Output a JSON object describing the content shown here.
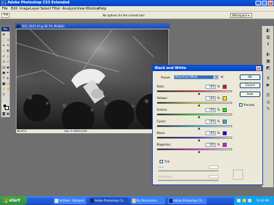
{
  "window": {
    "app_title": "Adobe Photoshop CS3 Extended",
    "minimize": "_",
    "maximize": "□",
    "close": "×"
  },
  "menubar": {
    "items": [
      "File",
      "Edit",
      "Image",
      "Layer",
      "Select",
      "Filter",
      "Analysis",
      "View",
      "Window",
      "Help"
    ]
  },
  "options_bar": {
    "tool_preset_icon": "eyedropper-icon",
    "message": "No options for the current tool.",
    "workspace_label": "Workspace ▾"
  },
  "toolbox": {
    "badge": "Ps"
  },
  "document": {
    "title": "DSC_0012.tif @ 66.7% (RGB/8)",
    "zoom_status": "66.67%",
    "doc_size": "Doc: 5.25M/5.25M"
  },
  "bw_dialog": {
    "title": "Black and White",
    "preset_label": "Preset:",
    "preset_value": "Maximum White",
    "ok_label": "OK",
    "cancel_label": "Cancel",
    "auto_label": "Auto",
    "preview_label": "Preview",
    "preview_checked": true,
    "sliders": [
      {
        "label": "Reds:",
        "value": "100",
        "unit": "%",
        "color": "#ff0000",
        "fraction": 0.56
      },
      {
        "label": "Yellows:",
        "value": "100",
        "unit": "%",
        "color": "#ffff00",
        "fraction": 0.56
      },
      {
        "label": "Greens:",
        "value": "100",
        "unit": "%",
        "color": "#00ff00",
        "fraction": 0.56
      },
      {
        "label": "Cyans:",
        "value": "100",
        "unit": "%",
        "color": "#00bfff",
        "fraction": 0.56
      },
      {
        "label": "Blues:",
        "value": "100",
        "unit": "%",
        "color": "#0000ff",
        "fraction": 0.56
      },
      {
        "label": "Magentas:",
        "value": "100",
        "unit": "%",
        "color": "#ff00ff",
        "fraction": 0.56
      }
    ],
    "tint_label": "Tint",
    "tint_checked": false,
    "hue_label": "Hue",
    "saturation_label": "Saturation"
  },
  "taskbar": {
    "start_label": "start",
    "tasks": [
      {
        "label": "Untitled - Notepad",
        "icon": "notepad-icon"
      },
      {
        "label": "Adobe Photoshop CS...",
        "icon": "photoshop-icon"
      },
      {
        "label": "My Documents",
        "icon": "folder-icon"
      },
      {
        "label": "Adobe Photoshop CS...",
        "icon": "photoshop-icon"
      }
    ],
    "clock": "10:40 PM"
  },
  "colors": {
    "xp_title_blue": "#0a58e3",
    "xp_taskbar_blue": "#245edb",
    "start_green": "#3fa64b",
    "dialog_bg": "#ece9d8",
    "preset_highlight": "#316ac5"
  }
}
